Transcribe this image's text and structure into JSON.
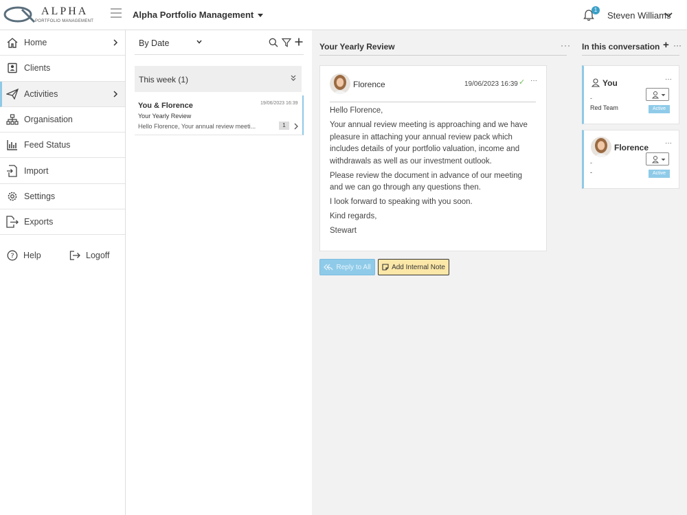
{
  "app": {
    "logo_word": "ALPHA",
    "logo_sub": "PORTFOLIO MANAGEMENT",
    "title": "Alpha Portfolio Management",
    "notification_count": "1",
    "user_name": "Steven Williams"
  },
  "sidebar": {
    "items": [
      {
        "label": "Home",
        "icon": "home-icon"
      },
      {
        "label": "Clients",
        "icon": "clients-icon"
      },
      {
        "label": "Activities",
        "icon": "paper-plane-icon"
      },
      {
        "label": "Organisation",
        "icon": "org-chart-icon"
      },
      {
        "label": "Feed Status",
        "icon": "bar-chart-icon"
      },
      {
        "label": "Import",
        "icon": "import-icon"
      },
      {
        "label": "Settings",
        "icon": "gear-icon"
      },
      {
        "label": "Exports",
        "icon": "export-icon"
      }
    ],
    "help_label": "Help",
    "logoff_label": "Logoff"
  },
  "list": {
    "sort_label": "By Date",
    "group_label": "This week (1)",
    "threads": [
      {
        "from": "You & Florence",
        "date": "19/06/2023 16:39",
        "subject": "Your Yearly Review",
        "preview": "Hello Florence, Your annual review meeti...",
        "count": "1"
      }
    ]
  },
  "conversation": {
    "title": "Your Yearly Review",
    "more": "···",
    "message": {
      "sender": "Florence",
      "date": "19/06/2023 16:39",
      "check": "✓",
      "more": "···",
      "body": [
        "Hello Florence,",
        "Your annual review meeting is approaching and we have pleasure in attaching your annual review pack which includes details of your portfolio valuation, income and withdrawals as well as our investment outlook.",
        "Please review the document in advance of our meeting and we can go through any questions then.",
        "I look forward to speaking with you soon.",
        "Kind regards,",
        "Stewart"
      ]
    },
    "reply_label": "Reply to All",
    "note_label": "Add Internal Note"
  },
  "participants": {
    "title": "In this conversation",
    "add": "+",
    "more": "···",
    "people": [
      {
        "name": "You",
        "line1": "-",
        "line2": "Red Team",
        "status": "Active",
        "more": "···"
      },
      {
        "name": "Florence",
        "line1": "-",
        "line2": "-",
        "status": "Active",
        "more": "···"
      }
    ]
  },
  "colors": {
    "accent": "#8fc9e6",
    "badge": "#3aa0c8",
    "note_button": "#fbe7a7",
    "check": "#6bbf4e"
  }
}
